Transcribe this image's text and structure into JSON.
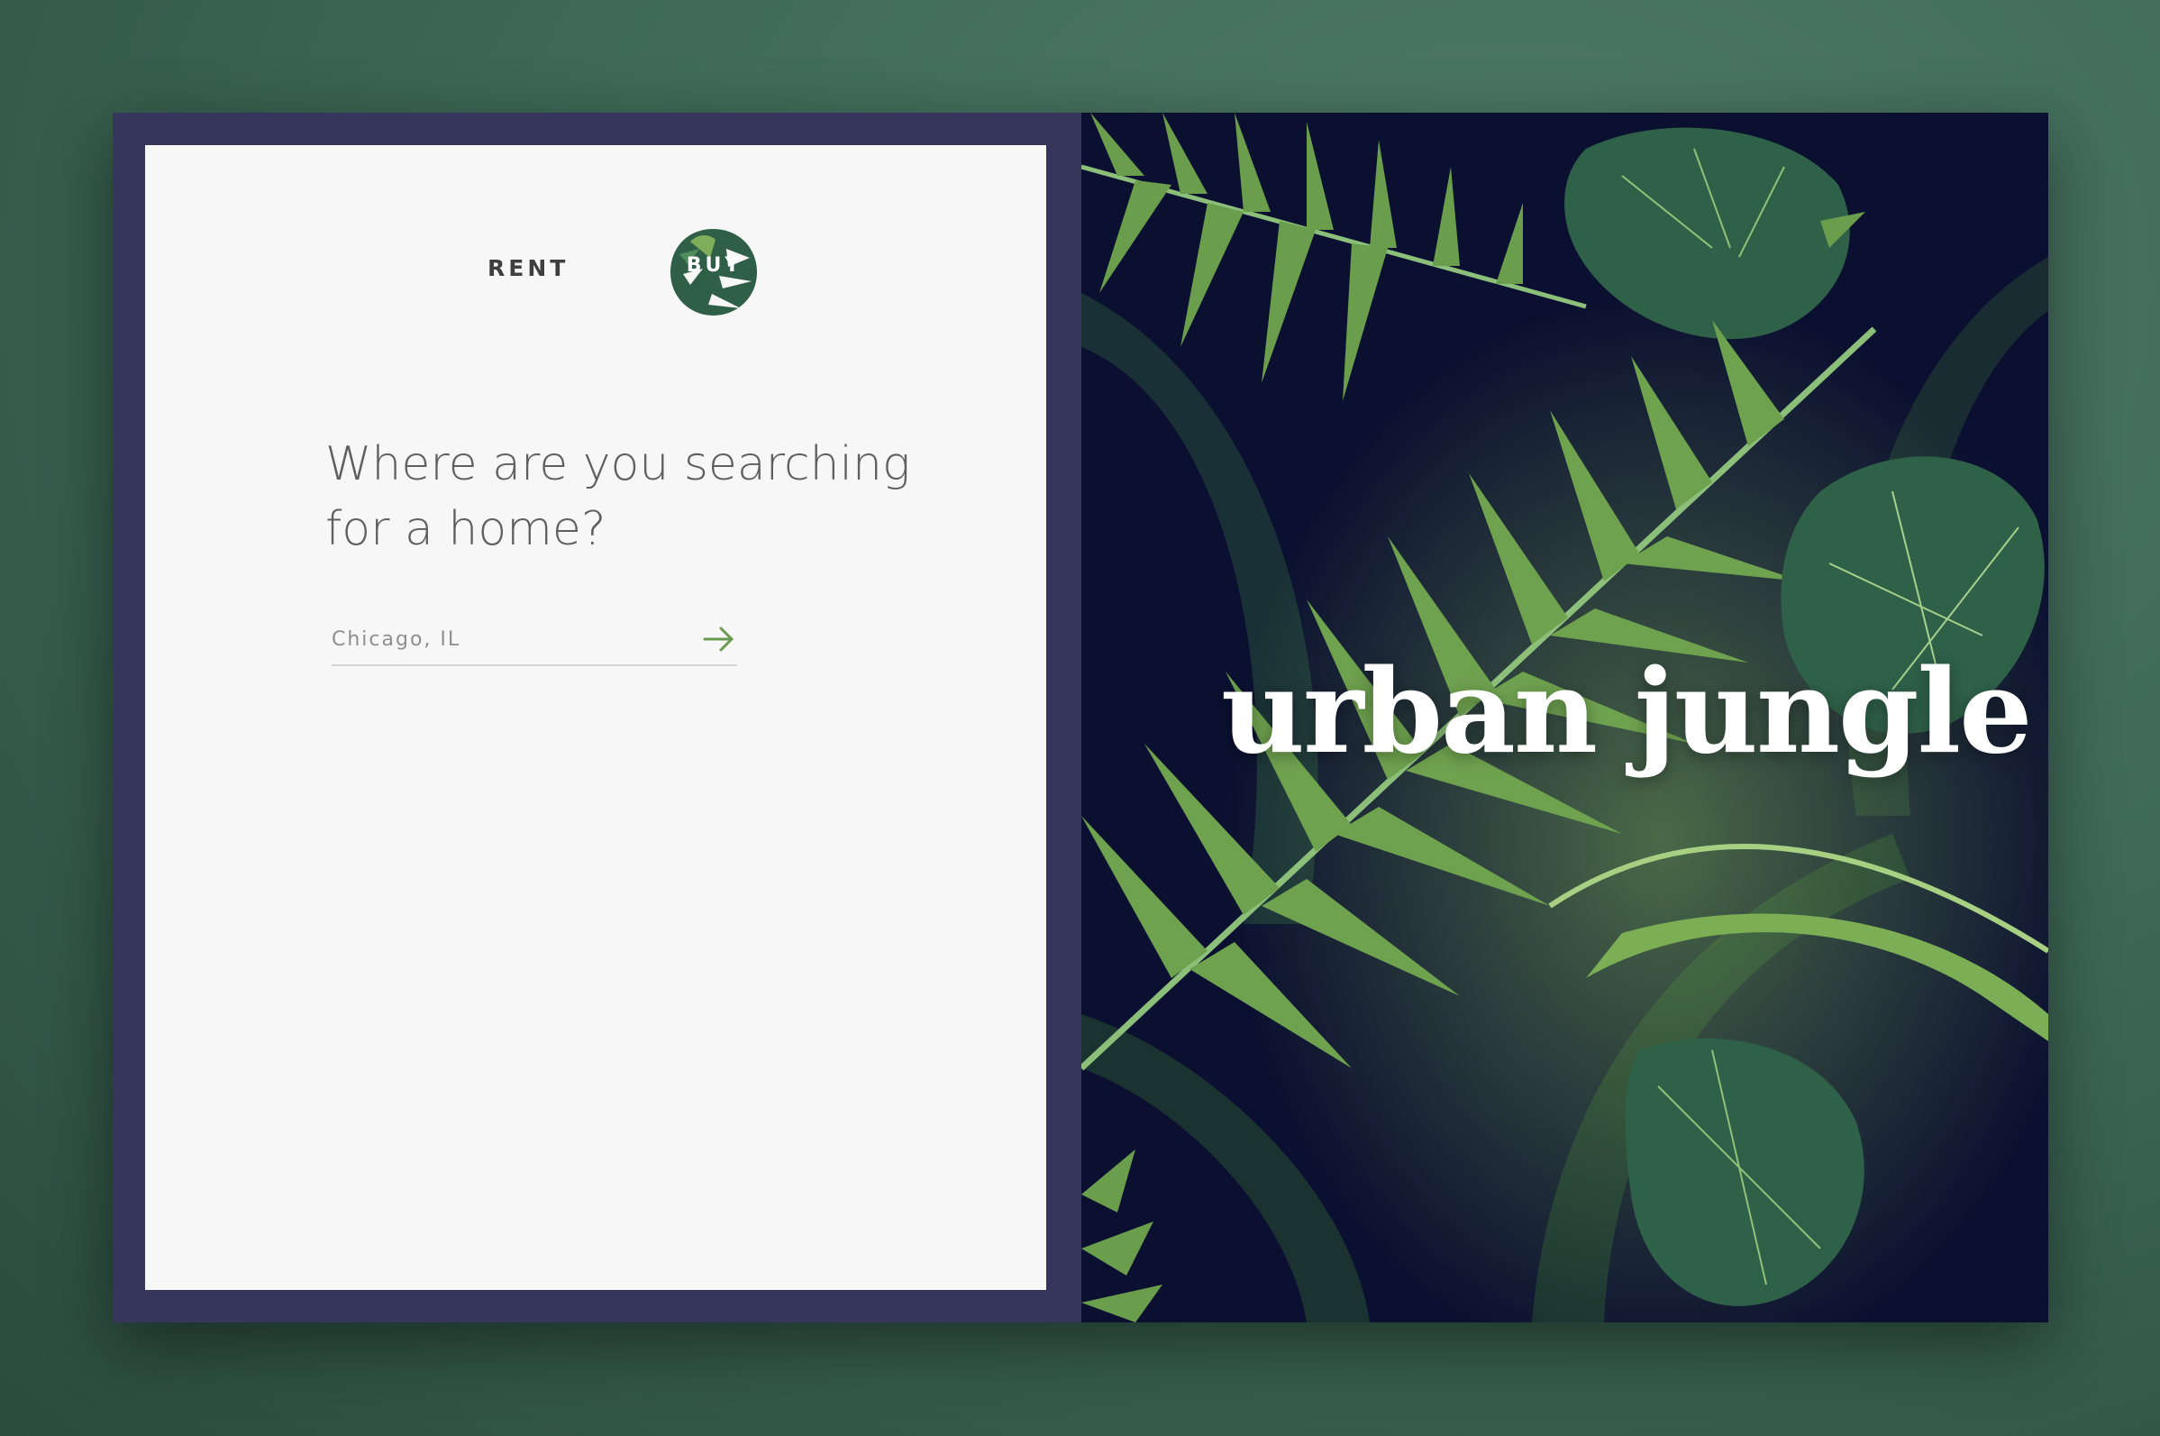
{
  "tabs": {
    "rent_label": "RENT",
    "buy_label": "BUY",
    "active": "BUY"
  },
  "search": {
    "headline_line1": "Where are you searching",
    "headline_line2": "for a home?",
    "placeholder": "Chicago, IL",
    "submit_icon": "arrow-right-icon"
  },
  "hero": {
    "brand_text": "urban jungle"
  },
  "colors": {
    "page_background": "#3e6a57",
    "frame": "#36365c",
    "panel": "#f7f7f7",
    "accent_green": "#6a9a52",
    "leaf_dark": "#2e5e45",
    "jungle_background": "#0b1030"
  }
}
